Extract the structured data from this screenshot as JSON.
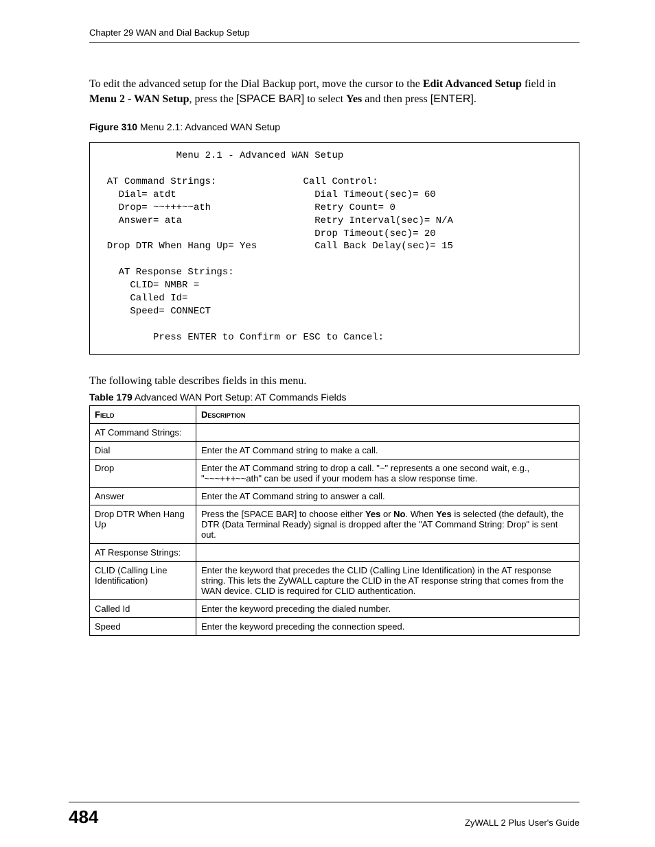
{
  "header": {
    "chapter": "Chapter 29 WAN and Dial Backup Setup"
  },
  "intro": {
    "p1_a": "To edit the advanced setup for the Dial Backup port, move the cursor to the ",
    "p1_b": "Edit Advanced Setup",
    "p1_c": " field in ",
    "p1_d": "Menu 2 - WAN Setup",
    "p1_e": ", press the ",
    "p1_f": "[SPACE BAR]",
    "p1_g": " to select ",
    "p1_h": "Yes",
    "p1_i": " and then press ",
    "p1_j": "[ENTER]",
    "p1_k": "."
  },
  "figure": {
    "label": "Figure 310",
    "title": "   Menu 2.1: Advanced WAN Setup"
  },
  "terminal": "              Menu 2.1 - Advanced WAN Setup\n\n  AT Command Strings:               Call Control:\n    Dial= atdt                        Dial Timeout(sec)= 60\n    Drop= ~~+++~~ath                  Retry Count= 0\n    Answer= ata                       Retry Interval(sec)= N/A\n                                      Drop Timeout(sec)= 20\n  Drop DTR When Hang Up= Yes          Call Back Delay(sec)= 15\n\n    AT Response Strings:\n      CLID= NMBR =\n      Called Id=\n      Speed= CONNECT\n\n          Press ENTER to Confirm or ESC to Cancel:",
  "mid": {
    "text": "The following table describes fields in this menu."
  },
  "table": {
    "label": "Table 179",
    "title": "   Advanced WAN Port Setup: AT Commands Fields",
    "head_field": "Field",
    "head_desc": "Description",
    "rows": [
      {
        "field": "AT Command Strings:",
        "desc": ""
      },
      {
        "field": "Dial",
        "desc": "Enter the AT Command string to make a call."
      },
      {
        "field": "Drop",
        "desc": "Enter the AT Command string to drop a call. \"~\" represents a one second wait, e.g., \"~~~+++~~ath\" can be used if your modem has a slow response time."
      },
      {
        "field": "Answer",
        "desc": "Enter the AT Command string to answer a call."
      },
      {
        "field": "Drop DTR When Hang Up",
        "desc_html": "Press the [SPACE BAR] to choose either <b>Yes</b> or <b>No</b>. When <b>Yes</b> is selected (the default), the DTR (Data Terminal Ready) signal is dropped after the \"AT Command String: Drop\" is sent out."
      },
      {
        "field": "AT Response Strings:",
        "desc": ""
      },
      {
        "field": "CLID (Calling Line Identification)",
        "desc": "Enter the keyword that precedes the CLID (Calling Line Identification) in the AT response string. This lets the ZyWALL capture the CLID in the AT response string that comes from the WAN device. CLID is required for CLID authentication."
      },
      {
        "field": "Called Id",
        "desc": "Enter the keyword preceding the dialed number."
      },
      {
        "field": "Speed",
        "desc": "Enter the keyword preceding the connection speed."
      }
    ]
  },
  "footer": {
    "page": "484",
    "guide": "ZyWALL 2 Plus User's Guide"
  }
}
